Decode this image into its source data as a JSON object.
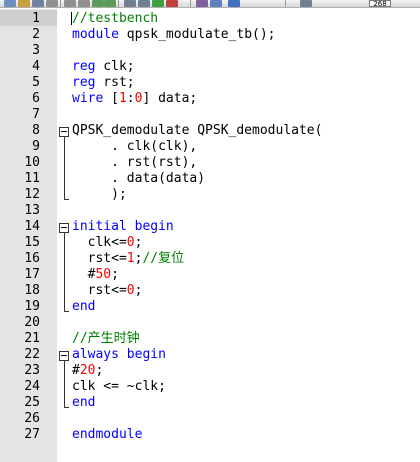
{
  "toolbar": {
    "zoom_label": "268",
    "buttons": [
      "new-file-icon",
      "open-file-icon",
      "save-icon",
      "cut-icon",
      "copy-icon",
      "paste-icon",
      "undo-icon",
      "redo-icon",
      "find-icon",
      "replace-icon",
      "run-icon",
      "stop-icon",
      "bookmark-icon",
      "settings-icon",
      "zoom-icon",
      "help-icon"
    ]
  },
  "editor": {
    "line_numbers": [
      "1",
      "2",
      "3",
      "4",
      "5",
      "6",
      "7",
      "8",
      "9",
      "10",
      "11",
      "12",
      "13",
      "14",
      "15",
      "16",
      "17",
      "18",
      "19",
      "20",
      "21",
      "22",
      "23",
      "24",
      "25",
      "26",
      "27"
    ],
    "lines": [
      [
        {
          "t": "//testbench",
          "c": "cm"
        }
      ],
      [
        {
          "t": "module",
          "c": "kw"
        },
        {
          "t": " qpsk_modulate_tb();",
          "c": ""
        }
      ],
      [],
      [
        {
          "t": "reg",
          "c": "kw"
        },
        {
          "t": " clk;",
          "c": ""
        }
      ],
      [
        {
          "t": "reg",
          "c": "kw"
        },
        {
          "t": " rst;",
          "c": ""
        }
      ],
      [
        {
          "t": "wire",
          "c": "kw"
        },
        {
          "t": " [",
          "c": ""
        },
        {
          "t": "1",
          "c": "num"
        },
        {
          "t": ":",
          "c": ""
        },
        {
          "t": "0",
          "c": "num"
        },
        {
          "t": "] data;",
          "c": ""
        }
      ],
      [],
      [
        {
          "t": "QPSK_demodulate QPSK_demodulate(",
          "c": ""
        }
      ],
      [
        {
          "t": "     . clk(clk),",
          "c": ""
        }
      ],
      [
        {
          "t": "     . rst(rst),",
          "c": ""
        }
      ],
      [
        {
          "t": "     . data(data)",
          "c": ""
        }
      ],
      [
        {
          "t": "     );",
          "c": ""
        }
      ],
      [],
      [
        {
          "t": "initial",
          "c": "kw"
        },
        {
          "t": " ",
          "c": ""
        },
        {
          "t": "begin",
          "c": "kw"
        }
      ],
      [
        {
          "t": "  clk<=",
          "c": ""
        },
        {
          "t": "0",
          "c": "num"
        },
        {
          "t": ";",
          "c": ""
        }
      ],
      [
        {
          "t": "  rst<=",
          "c": ""
        },
        {
          "t": "1",
          "c": "num"
        },
        {
          "t": ";",
          "c": ""
        },
        {
          "t": "//复位",
          "c": "cm"
        }
      ],
      [
        {
          "t": "  #",
          "c": ""
        },
        {
          "t": "50",
          "c": "num"
        },
        {
          "t": ";",
          "c": ""
        }
      ],
      [
        {
          "t": "  rst<=",
          "c": ""
        },
        {
          "t": "0",
          "c": "num"
        },
        {
          "t": ";",
          "c": ""
        }
      ],
      [
        {
          "t": "end",
          "c": "kw"
        }
      ],
      [],
      [
        {
          "t": "//产生时钟",
          "c": "cm"
        }
      ],
      [
        {
          "t": "always",
          "c": "kw"
        },
        {
          "t": " ",
          "c": ""
        },
        {
          "t": "begin",
          "c": "kw"
        }
      ],
      [
        {
          "t": "#",
          "c": ""
        },
        {
          "t": "20",
          "c": "num"
        },
        {
          "t": ";",
          "c": ""
        }
      ],
      [
        {
          "t": "clk <= ~clk;",
          "c": ""
        }
      ],
      [
        {
          "t": "end",
          "c": "kw"
        }
      ],
      [],
      [
        {
          "t": "endmodule",
          "c": "kw"
        }
      ]
    ]
  }
}
